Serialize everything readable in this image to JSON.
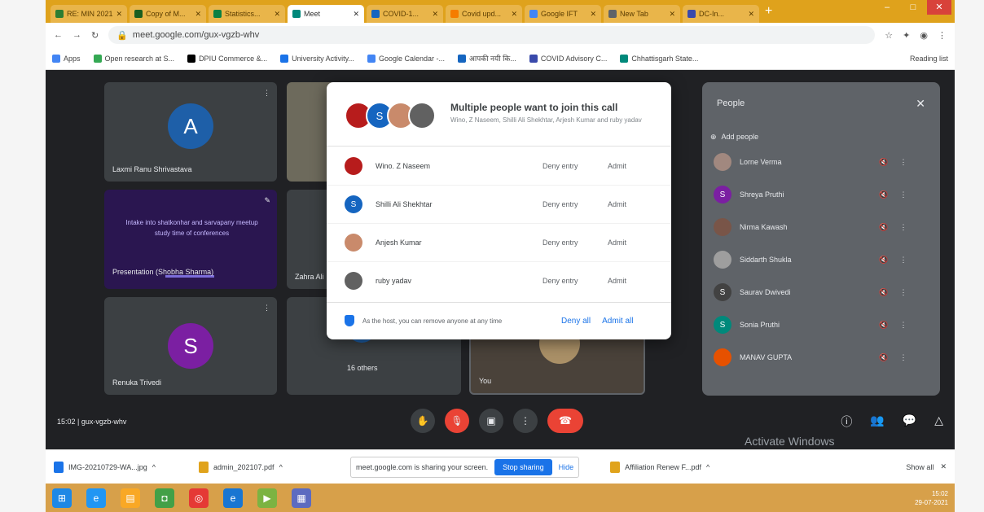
{
  "browser": {
    "tabs": [
      {
        "label": "RE: MIN 2021",
        "color": "#2e7d32",
        "active": false
      },
      {
        "label": "Copy of M...",
        "color": "#1b5e20",
        "active": false
      },
      {
        "label": "Statistics...",
        "color": "#0b8043",
        "active": false
      },
      {
        "label": "Meet",
        "color": "#00897b",
        "active": true
      },
      {
        "label": "COVID-1...",
        "color": "#1565c0",
        "active": false
      },
      {
        "label": "Covid upd...",
        "color": "#f57c00",
        "active": false
      },
      {
        "label": "Google IFT",
        "color": "#4285f4",
        "active": false
      },
      {
        "label": "New Tab",
        "color": "#5f6368",
        "active": false
      },
      {
        "label": "DC-In...",
        "color": "#3949ab",
        "active": false
      }
    ],
    "url": "meet.google.com/gux-vgzb-whv",
    "bookmarks": [
      "Apps",
      "Open research at S...",
      "DPIU Commerce &...",
      "University Activity...",
      "Google Calendar -...",
      "आपकी नयी कि...",
      "COVID Advisory C...",
      "Chhattisgarh State..."
    ],
    "reading_list": "Reading list"
  },
  "stage": {
    "tiles": [
      {
        "name": "Laxmi Ranu Shrivastava",
        "initial": "A",
        "color": "#1e5fa8"
      },
      {
        "name": "Presentation (Shobha Sharma)",
        "initial": "",
        "color": ""
      },
      {
        "name": "Renuka Trivedi",
        "initial": "S",
        "color": "#7b1fa2"
      },
      {
        "name": "Zahra Ali",
        "initial": "",
        "color": ""
      },
      {
        "name": "16 others",
        "initial": "",
        "color": ""
      },
      {
        "name": "You",
        "initial": "",
        "color": ""
      }
    ],
    "presentation_text": "Intake into shatkonhar and sarvapany meetup study time of conferences"
  },
  "dialog": {
    "title": "Multiple people want to join this call",
    "subtitle": "Wino, Z Naseem, Shilli Ali Shekhtar, Arjesh Kumar and ruby yadav",
    "requests": [
      {
        "name": "Wino. Z Naseem",
        "initial": "",
        "color": "#b71c1c"
      },
      {
        "name": "Shilli Ali Shekhtar",
        "initial": "S",
        "color": "#1565c0"
      },
      {
        "name": "Anjesh Kumar",
        "initial": "",
        "color": "#c98a6b"
      },
      {
        "name": "ruby yadav",
        "initial": "",
        "color": "#616161"
      }
    ],
    "deny_label": "Deny entry",
    "admit_label": "Admit",
    "footer_note": "As the host, you can remove anyone at any time",
    "deny_all": "Deny all",
    "admit_all": "Admit all"
  },
  "people": {
    "title": "People",
    "add_people": "Add people",
    "list": [
      {
        "name": "Lorne Verma",
        "initial": "",
        "color": "#a1887f"
      },
      {
        "name": "Shreya Pruthi",
        "initial": "S",
        "color": "#7b1fa2"
      },
      {
        "name": "Nirma Kawash",
        "initial": "",
        "color": "#795548"
      },
      {
        "name": "Siddarth Shukla",
        "initial": "",
        "color": "#9e9e9e"
      },
      {
        "name": "Saurav Dwivedi",
        "initial": "S",
        "color": "#424242"
      },
      {
        "name": "Sonia Pruthi",
        "initial": "S",
        "color": "#00897b"
      },
      {
        "name": "MANAV GUPTA",
        "initial": "",
        "color": "#e65100"
      }
    ]
  },
  "bottombar": {
    "meeting_info": "15:02 | gux-vgzb-whv",
    "activate_windows": "Activate Windows"
  },
  "downloads": {
    "items": [
      {
        "name": "IMG-20210729-WA...jpg",
        "color": "#1a73e8"
      },
      {
        "name": "admin_202107.pdf",
        "color": "#e0a31c"
      }
    ],
    "share_text": "meet.google.com is sharing your screen.",
    "stop_label": "Stop sharing",
    "hide_label": "Hide",
    "last_item": "Affiliation Renew F...pdf",
    "show_all": "Show all"
  },
  "taskbar": {
    "apps": [
      "windows",
      "ie",
      "explorer",
      "store",
      "chrome",
      "edge",
      "media",
      "calendar"
    ],
    "time": "15:02",
    "date": "29-07-2021"
  }
}
